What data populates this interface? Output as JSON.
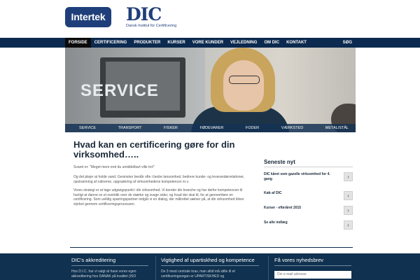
{
  "brand": {
    "intertek": "Intertek",
    "dic": "DIC",
    "dic_sub": "Dansk Institut for Certificering",
    "primary_color": "#0c2a4f"
  },
  "nav": {
    "items": [
      "FORSIDE",
      "CERTIFICERING",
      "PRODUKTER",
      "KURSER",
      "VORE KUNDER",
      "VEJLEDNING",
      "OM DIC",
      "KONTAKT"
    ],
    "active": "FORSIDE",
    "search": "SØG"
  },
  "hero": {
    "title": "SERVICE",
    "tabs": [
      "SERVICE",
      "TRANSPORT",
      "FISKER",
      "FØDEVARER",
      "FODER",
      "VÆRKSTED",
      "METAL/STÅL"
    ]
  },
  "main": {
    "title": "Hvad kan en certificering gøre for din virksomhed…..",
    "p1": "Svaret er: \"Meget mere end du umiddelbart ville tro!\"",
    "p2": "Og det plejer at holde vand. Gevinsten består ofte i bedre lønsomhed, bedrere kunde- og leverandørrelationer, opstramning af rutinerne, opgradering af virksomhedens kompetencer m.v.",
    "p3": "Vores strategi er at tage udgangspunkt i din virksomhed. Vi kender din branche og har derfor kompetencen til hurtigt at danne os et overblik over de stærke og svage sider, og hvad der skal til, for at gennemføre en certificering. Som uvildig sparringspartner indgår vi en dialog, der målrettet sætser på, at din virksomhed bliver styrket gennem certificeringsprocessen."
  },
  "news": {
    "title": "Seneste nyt",
    "items": [
      "DIC kåret som gazelle virksomhed for 4. gang",
      "Køb af DIC",
      "Kurser - efteråret 2015",
      "Se alle indlæg"
    ]
  },
  "footer": {
    "col1_title": "DIC's akkreditering",
    "col1_text": "Hos D.I.C. har vi valgt at have vores egen akkreditering hos DANAK på kvalitet (ISO",
    "col2_title": "Vigtighed af upartiskhed og kompetence",
    "col2_text": "De 3 mest centrale krav, man altid må stille til et certificeringsorgan er UPARTISKHED og",
    "col3_title": "Få vores nyhedsbrev",
    "email_placeholder": "Din e-mail adresse"
  }
}
